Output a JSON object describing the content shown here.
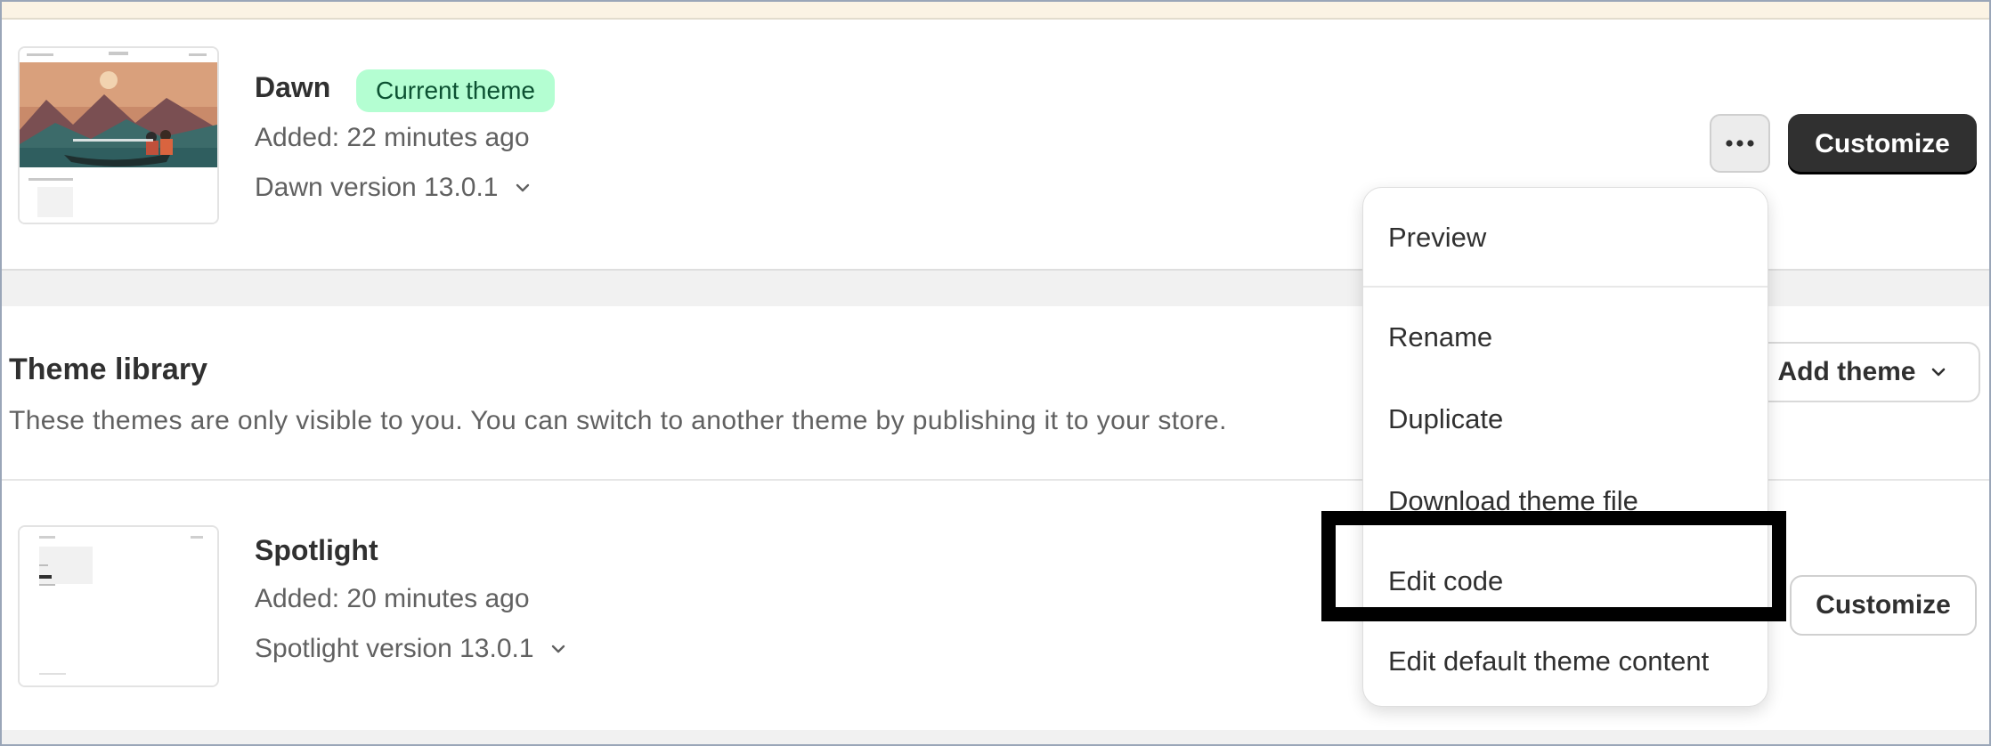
{
  "current_theme": {
    "name": "Dawn",
    "badge": "Current theme",
    "added": "Added: 22 minutes ago",
    "version": "Dawn version 13.0.1",
    "customize_label": "Customize"
  },
  "library": {
    "title": "Theme library",
    "description": "These themes are only visible to you. You can switch to another theme by publishing it to your store.",
    "add_theme_label": "Add theme"
  },
  "library_themes": [
    {
      "name": "Spotlight",
      "added": "Added: 20 minutes ago",
      "version": "Spotlight version 13.0.1",
      "customize_label": "Customize"
    }
  ],
  "actions_menu": {
    "items": [
      "Preview",
      "Rename",
      "Duplicate",
      "Download theme file",
      "Edit code",
      "Edit default theme content"
    ],
    "highlighted": "Edit code"
  },
  "icons": {
    "more": "more-horizontal-icon",
    "chevron": "chevron-down-icon"
  },
  "colors": {
    "badge_bg": "#b4fed2",
    "badge_text": "#0c5132",
    "primary_button": "#303030"
  }
}
